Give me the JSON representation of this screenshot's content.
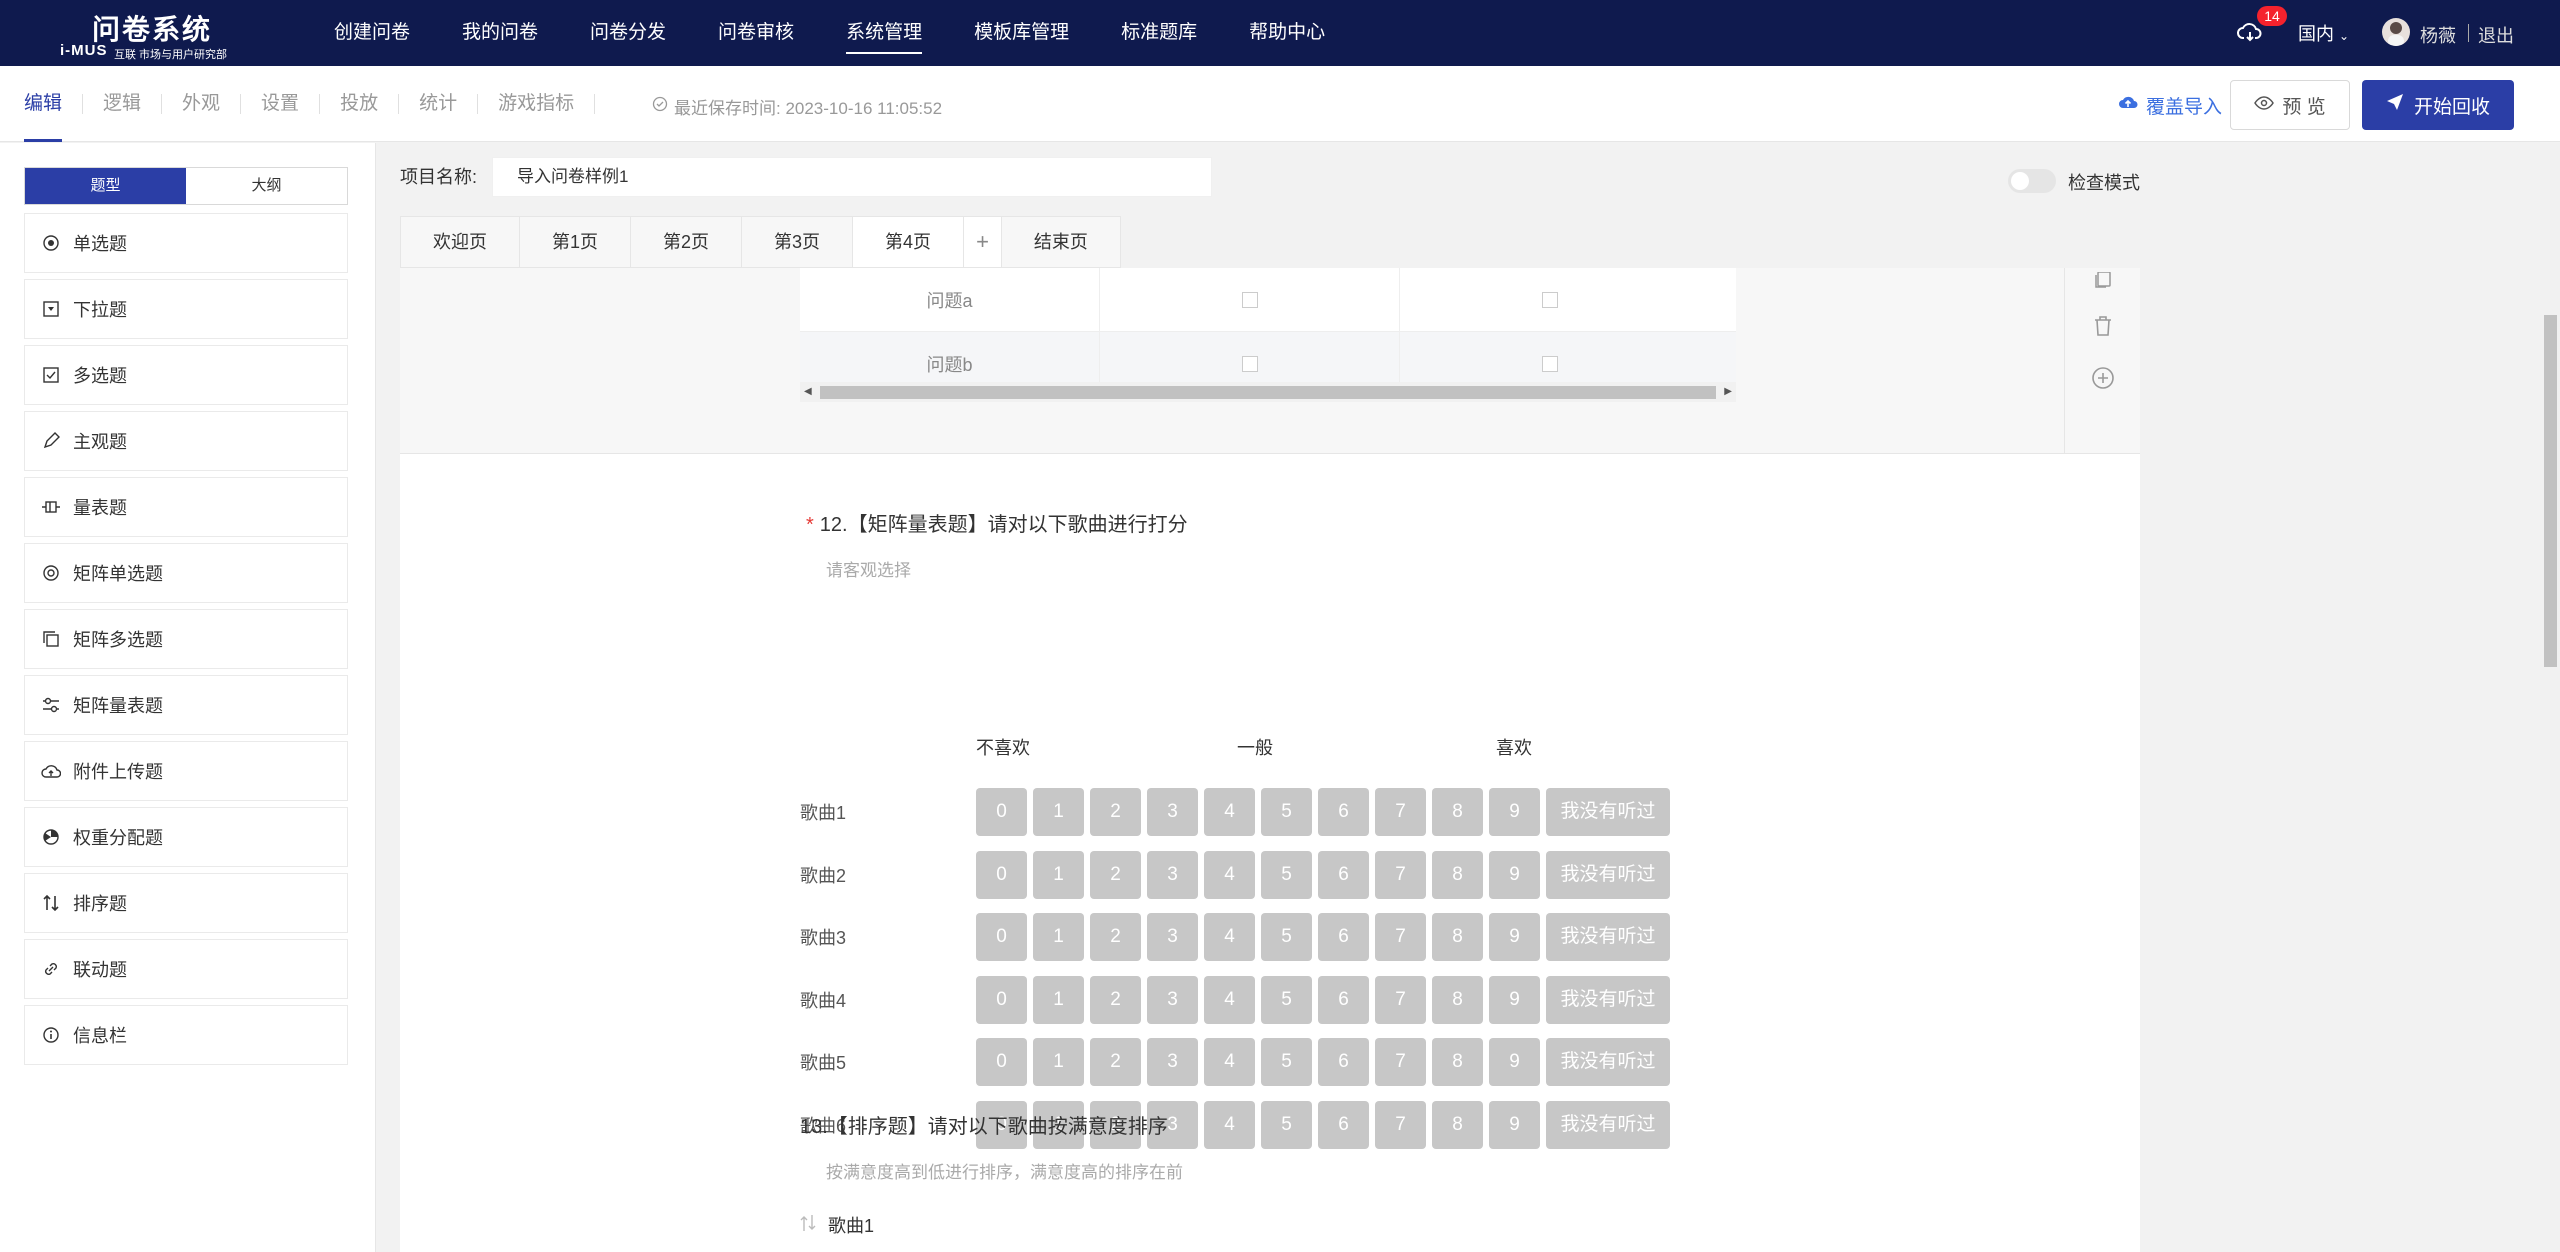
{
  "app": {
    "logo_title": "问卷系统",
    "logo_mark": "i-MUS",
    "logo_sub": "互联 市场与用户研究部"
  },
  "nav": {
    "items": [
      "创建问卷",
      "我的问卷",
      "问卷分发",
      "问卷审核",
      "系统管理",
      "模板库管理",
      "标准题库",
      "帮助中心"
    ],
    "active": "系统管理",
    "badge_count": "14",
    "region": "国内",
    "username": "杨薇",
    "logout": "退出"
  },
  "toolbar": {
    "tabs": [
      "编辑",
      "逻辑",
      "外观",
      "设置",
      "投放",
      "统计",
      "游戏指标"
    ],
    "active": "编辑",
    "save_info": "最近保存时间: 2023-10-16 11:05:52",
    "import_label": "覆盖导入",
    "preview_label": "预 览",
    "start_label": "开始回收"
  },
  "sidebar": {
    "segments": [
      "题型",
      "大纲"
    ],
    "question_types": [
      {
        "label": "单选题",
        "icon": "radio-icon"
      },
      {
        "label": "下拉题",
        "icon": "dropdown-icon"
      },
      {
        "label": "多选题",
        "icon": "checkbox-icon"
      },
      {
        "label": "主观题",
        "icon": "pencil-icon"
      },
      {
        "label": "量表题",
        "icon": "scale-icon"
      },
      {
        "label": "矩阵单选题",
        "icon": "matrix-radio-icon"
      },
      {
        "label": "矩阵多选题",
        "icon": "matrix-checkbox-icon"
      },
      {
        "label": "矩阵量表题",
        "icon": "sliders-icon"
      },
      {
        "label": "附件上传题",
        "icon": "upload-icon"
      },
      {
        "label": "权重分配题",
        "icon": "pie-icon"
      },
      {
        "label": "排序题",
        "icon": "sort-icon"
      },
      {
        "label": "联动题",
        "icon": "link-icon"
      },
      {
        "label": "信息栏",
        "icon": "info-icon"
      }
    ]
  },
  "project": {
    "label": "项目名称:",
    "name": "导入问卷样例1",
    "check_mode": "检查模式"
  },
  "pages": {
    "tabs": [
      "欢迎页",
      "第1页",
      "第2页",
      "第3页",
      "第4页",
      "+",
      "结束页"
    ],
    "active": "第4页"
  },
  "prev_question": {
    "rows": [
      "问题a",
      "问题b"
    ]
  },
  "q12": {
    "required": "*",
    "title": "12.【矩阵量表题】请对以下歌曲进行打分",
    "hint": "请客观选择",
    "scale_labels": {
      "low": "不喜欢",
      "mid": "一般",
      "high": "喜欢"
    },
    "rows": [
      "歌曲1",
      "歌曲2",
      "歌曲3",
      "歌曲4",
      "歌曲5",
      "歌曲6"
    ],
    "scores": [
      "0",
      "1",
      "2",
      "3",
      "4",
      "5",
      "6",
      "7",
      "8",
      "9"
    ],
    "na_label": "我没有听过"
  },
  "q13": {
    "title": "13.【排序题】请对以下歌曲按满意度排序",
    "hint": "按满意度高到低进行排序，满意度高的排序在前",
    "first_item": "歌曲1"
  },
  "colors": {
    "nav_bg": "#0f1a4e",
    "accent": "#2b3ea6",
    "score_bg": "#c7c7c7",
    "badge": "#f5222d"
  }
}
